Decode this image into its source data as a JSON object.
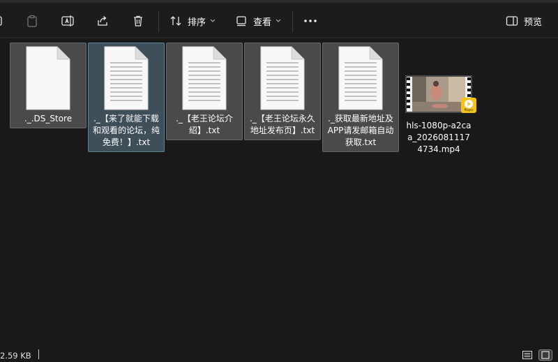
{
  "toolbar": {
    "sort_label": "排序",
    "view_label": "查看",
    "preview_label": "预览"
  },
  "files": [
    {
      "name": "._.DS_Store",
      "type": "file"
    },
    {
      "name": "._【来了就能下载和观看的论坛，纯免费！】.txt",
      "type": "txt"
    },
    {
      "name": "._【老王论坛介绍】.txt",
      "type": "txt"
    },
    {
      "name": "._【老王论坛永久地址发布页】.txt",
      "type": "txt"
    },
    {
      "name": "._获取最新地址及APP请发邮箱自动获取.txt",
      "type": "txt"
    },
    {
      "name": "hls-1080p-a2caa_20260811174734.mp4",
      "type": "video",
      "badge": "Player"
    }
  ],
  "status": {
    "size": "2.59 KB"
  },
  "colors": {
    "accent": "#f6c21c",
    "selection": "#3f4f5a"
  }
}
